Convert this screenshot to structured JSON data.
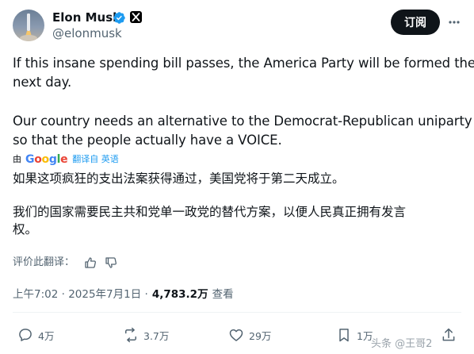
{
  "author": {
    "name": "Elon Musk",
    "handle": "@elonmusk",
    "avatar_icon": "rocket-launch-avatar",
    "verified_color": "#1d9bf0"
  },
  "header": {
    "subscribe_label": "订阅"
  },
  "post": {
    "lines": [
      "If this insane spending bill passes, the America Party will be formed the",
      "next day.",
      "Our country needs an alternative to the Democrat-Republican uniparty",
      "so that the people actually have a VOICE."
    ]
  },
  "translation": {
    "by": "由",
    "provider": "Google",
    "link": "翻译自 英语",
    "lines": [
      "如果这项疯狂的支出法案获得通过，美国党将于第二天成立。",
      "我们的国家需要民主共和党单一政党的替代方案，以便人民真正拥有发言",
      "权。"
    ],
    "rate_label": "评价此翻译："
  },
  "meta": {
    "time": "上午7:02",
    "date": "2025年7月1日",
    "views": "4,783.2万",
    "views_label": "查看"
  },
  "actions": {
    "replies": "4万",
    "reposts": "3.7万",
    "likes": "29万",
    "bookmarks": "1万"
  },
  "watermark": "头条 @王哥2"
}
